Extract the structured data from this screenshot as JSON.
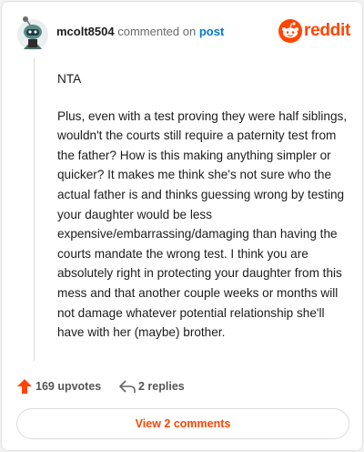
{
  "header": {
    "username": "mcolt8504",
    "action_text": "commented on",
    "post_link": "post",
    "brand": "reddit"
  },
  "comment": {
    "paragraphs": [
      "NTA",
      "Plus, even with a test proving they were half siblings, wouldn't the courts still require a paternity test from the father? How is this making anything simpler or quicker? It makes me think she's not sure who the actual father is and thinks guessing wrong by testing your daughter would be less expensive/embarrassing/damaging than having the courts mandate the wrong test. I think you are absolutely right in protecting your daughter from this mess and that another couple weeks or months will not damage whatever potential relationship she'll have with her (maybe) brother."
    ]
  },
  "actions": {
    "upvotes_label": "169 upvotes",
    "replies_label": "2 replies"
  },
  "footer": {
    "view_comments_label": "View 2 comments"
  },
  "colors": {
    "brand_orange": "#ff4500",
    "link_blue": "#0079d3",
    "avatar_bg": "#1b3a44"
  },
  "icons": [
    "avatar",
    "reddit-logo-icon",
    "upvote-arrow-icon",
    "reply-arrow-icon"
  ]
}
